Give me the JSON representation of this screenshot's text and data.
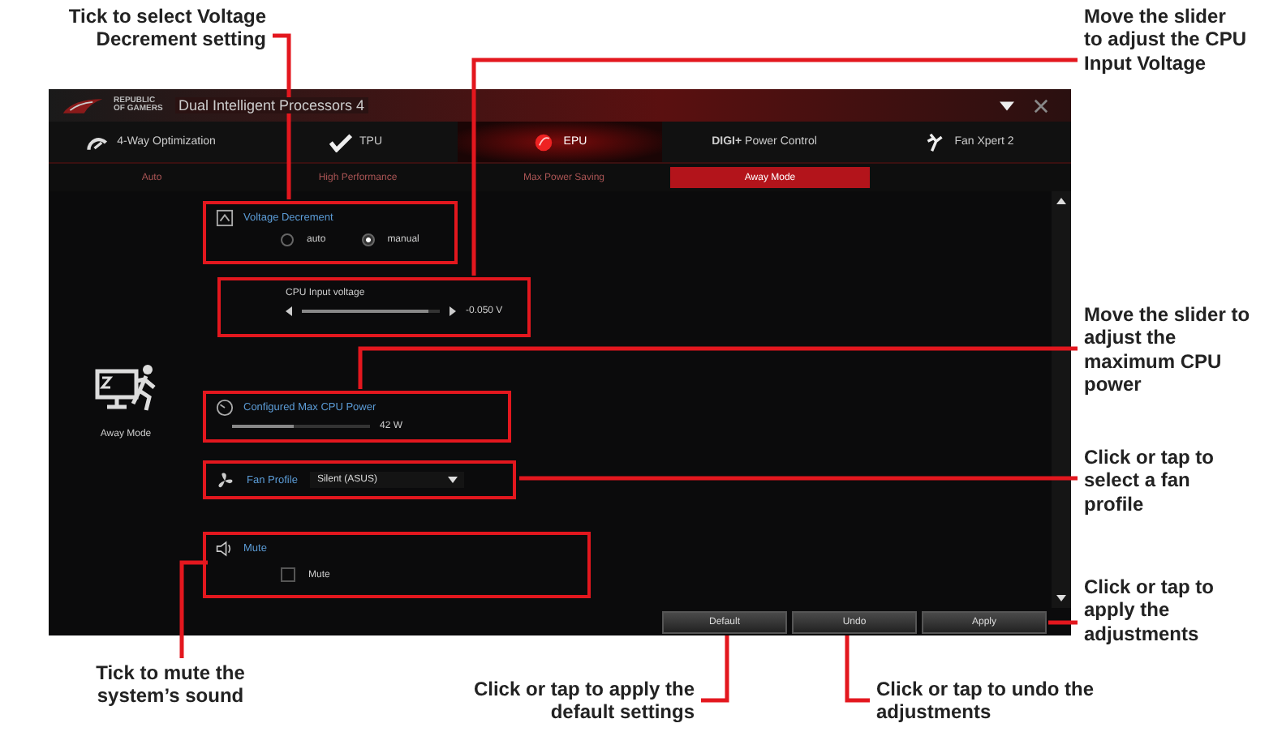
{
  "window": {
    "logo": "REPUBLIC OF GAMERS",
    "title": "Dual Intelligent Processors 4"
  },
  "tabs": [
    {
      "label": "4-Way Optimization",
      "selected": false
    },
    {
      "label": "TPU",
      "selected": false
    },
    {
      "label": "EPU",
      "selected": true
    },
    {
      "label": "**DIGI+** Power Control",
      "selected": false
    },
    {
      "label": "Fan Xpert 2",
      "selected": false
    }
  ],
  "subtabs": [
    {
      "label": "Auto",
      "selected": false
    },
    {
      "label": "High Performance",
      "selected": false
    },
    {
      "label": "Max Power Saving",
      "selected": false
    },
    {
      "label": "Away Mode",
      "selected": true
    }
  ],
  "mode": {
    "label": "Away Mode"
  },
  "voltage_decrement": {
    "title": "Voltage Decrement",
    "options": [
      {
        "label": "auto",
        "selected": false
      },
      {
        "label": "manual",
        "selected": true
      }
    ]
  },
  "cpu_input_voltage": {
    "label": "CPU Input voltage",
    "level": 0.92,
    "reading": "-0.050 V"
  },
  "max_cpu_power": {
    "title": "Configured Max CPU Power",
    "level": 0.45,
    "reading": "42 W"
  },
  "fan_profile": {
    "label": "Fan Profile",
    "value": "Silent (ASUS)"
  },
  "mute": {
    "title": "Mute",
    "option": {
      "label": "Mute",
      "checked": false
    }
  },
  "buttons": [
    "Default",
    "Undo",
    "Apply"
  ],
  "callouts": [
    {
      "text": "Tick to select Voltage Decrement setting"
    },
    {
      "text": "Move the slider to adjust the CPU Input Voltage"
    },
    {
      "text": "Move the slider to adjust the maximum CPU power"
    },
    {
      "text": "Click or tap to select a fan profile"
    },
    {
      "text": "Click or tap to apply the adjustments"
    },
    {
      "text": "Tick to mute the system’s sound"
    },
    {
      "text": "Click or tap to apply the default settings"
    },
    {
      "text": "Click or tap to undo the adjustments"
    }
  ]
}
